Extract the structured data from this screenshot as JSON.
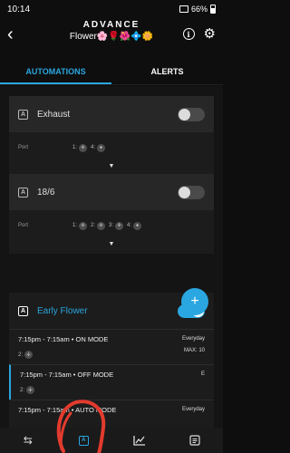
{
  "status": {
    "time": "10:14",
    "battery": "66%"
  },
  "header": {
    "app_title": "ADVANCE",
    "device_name": "Flower🌸🌹🌺💠🌼"
  },
  "tabs": [
    {
      "label": "AUTOMATIONS"
    },
    {
      "label": "ALERTS"
    }
  ],
  "cards": [
    {
      "title": "Exhaust",
      "port_label": "Port",
      "port_a": "1:",
      "port_b": "4:"
    },
    {
      "title": "18/6",
      "port_label": "Port",
      "port_a": "1:",
      "port_b": "2:",
      "port_c": "3:",
      "port_d": "4:"
    }
  ],
  "active_card": {
    "title": "Early Flower",
    "schedules": [
      {
        "text": "7:15pm - 7:15am • ON MODE",
        "day": "Everyday",
        "port": "2:",
        "max": "MAX: 10"
      },
      {
        "text": "7:15pm - 7:15am • OFF MODE",
        "day": "E",
        "port": "2:"
      },
      {
        "text": "7:15pm - 7:15am • AUTO MODE",
        "day": "Everyday"
      }
    ]
  },
  "fab": {
    "label": "+"
  },
  "nav": [
    {
      "name": "settings-sliders"
    },
    {
      "name": "automations"
    },
    {
      "name": "charts"
    },
    {
      "name": "logs"
    }
  ],
  "colors": {
    "accent": "#2aa6e0",
    "annotation": "#e23b2e"
  }
}
